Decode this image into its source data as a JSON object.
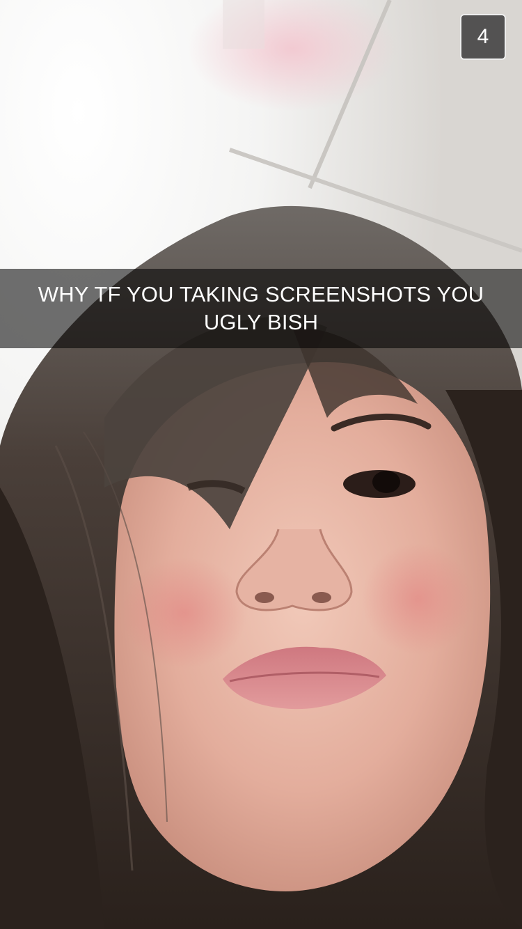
{
  "snap": {
    "timer": "4",
    "caption": "WHY TF YOU TAKING SCREENSHOTS YOU UGLY BISH"
  },
  "icons": {
    "timer": "countdown-timer-icon"
  },
  "colors": {
    "caption_bar": "#000000",
    "caption_text": "#ffffff",
    "timer_bg": "#404040",
    "timer_border": "#ffffff"
  }
}
